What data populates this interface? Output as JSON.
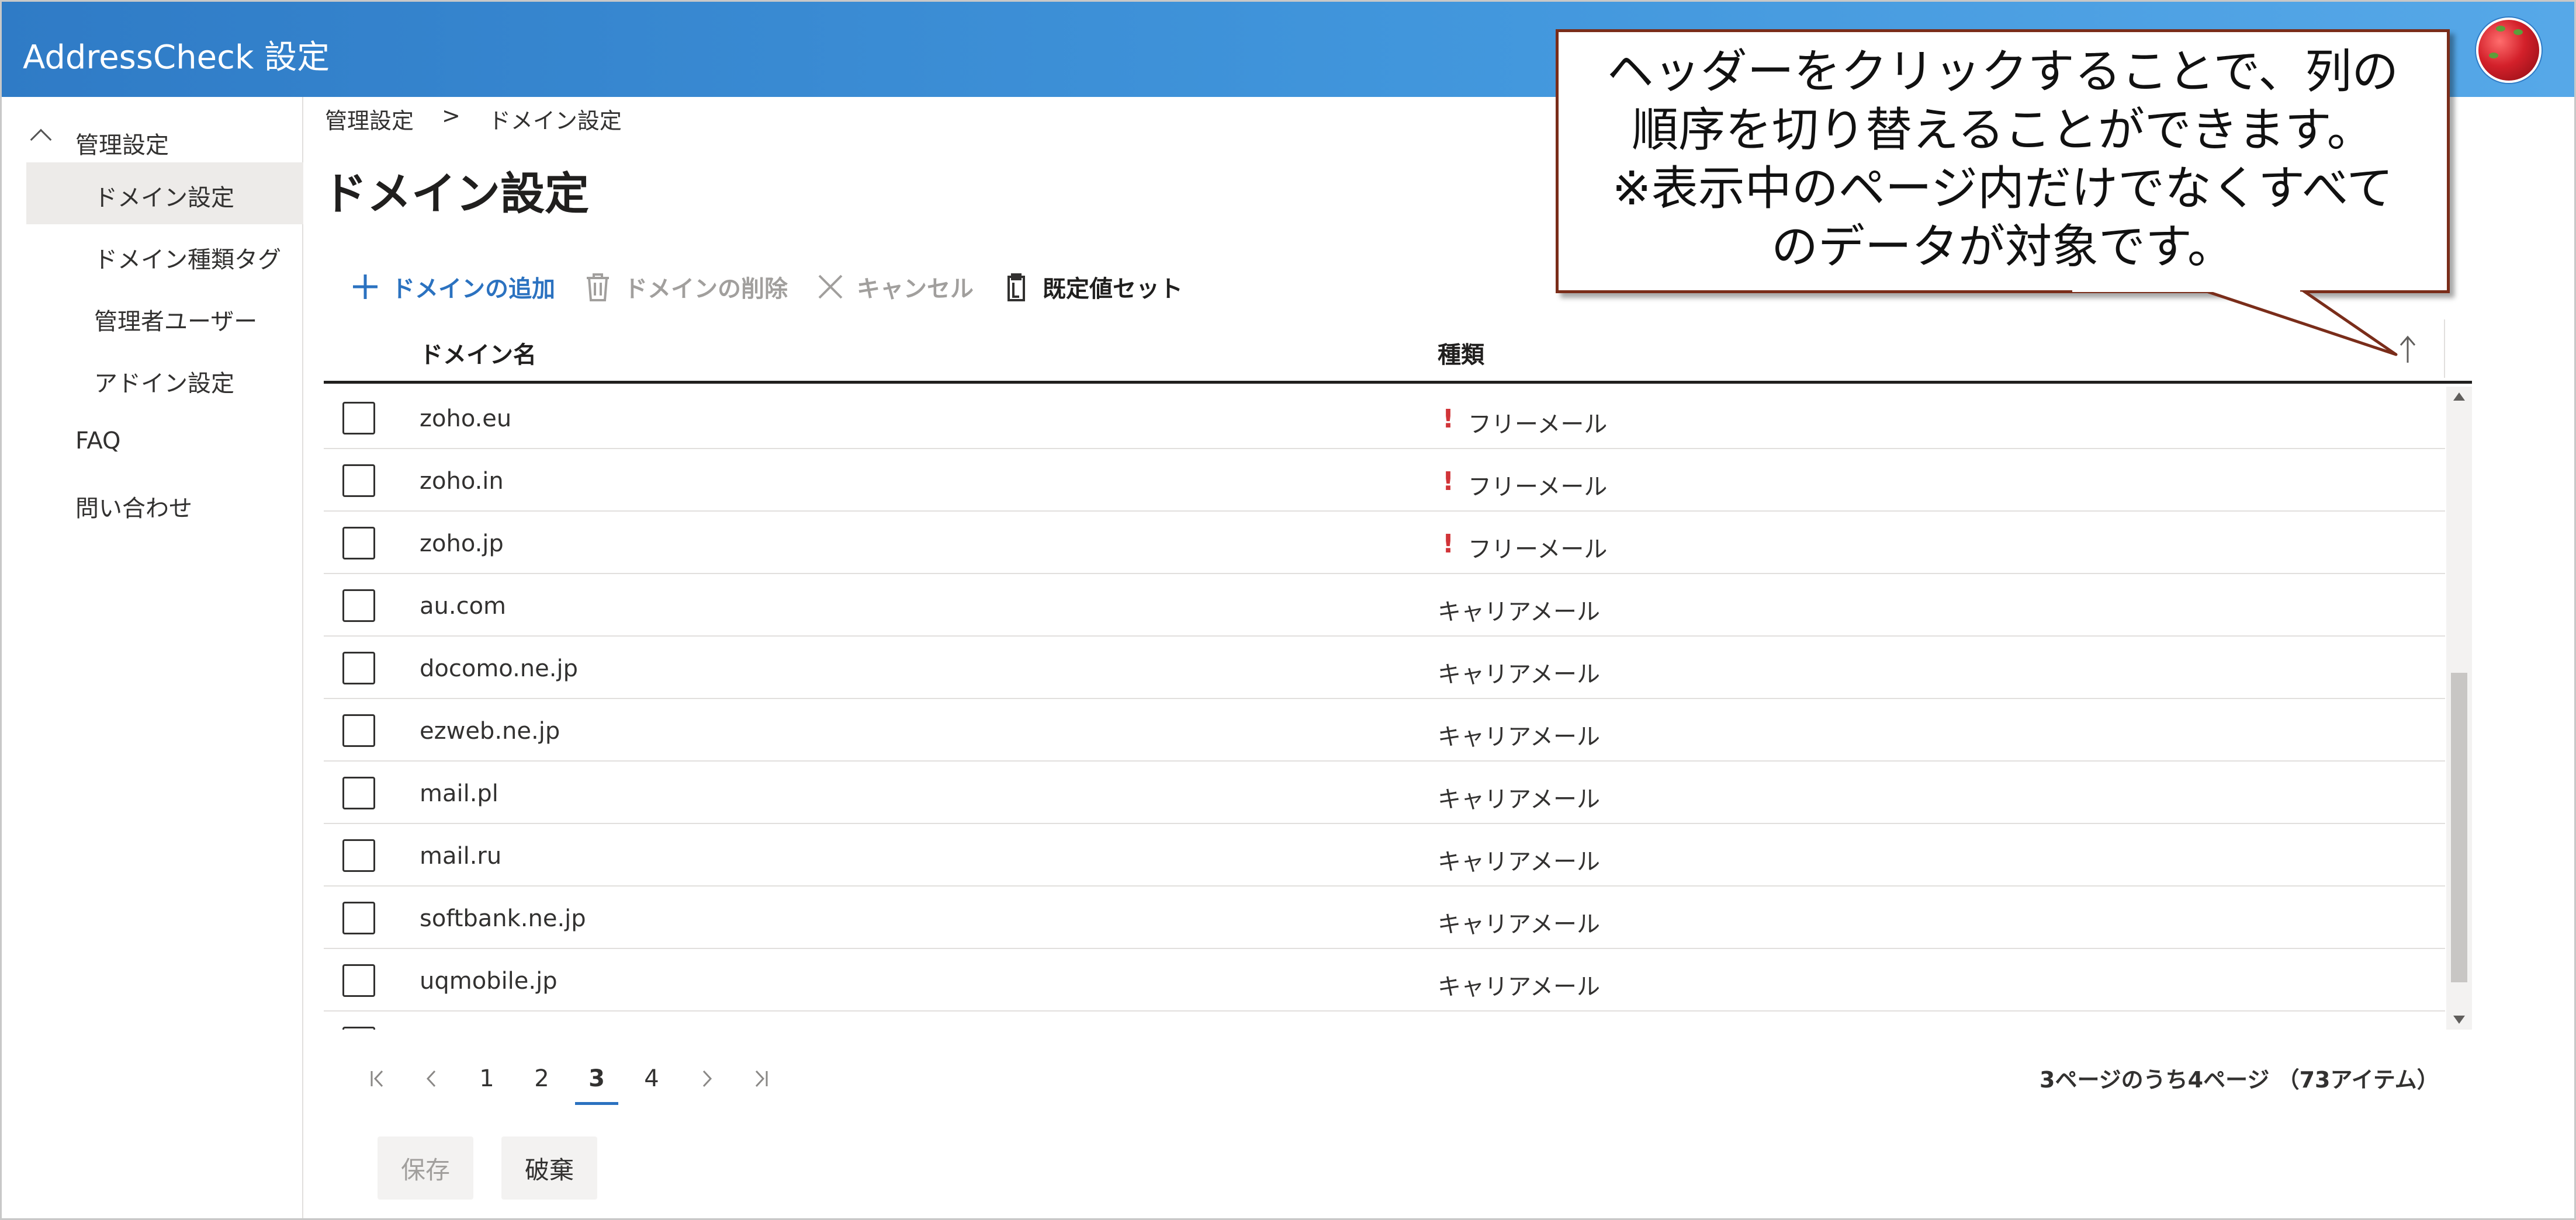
{
  "app": {
    "title": "AddressCheck 設定"
  },
  "sidebar": {
    "group": {
      "label": "管理設定",
      "expanded": true
    },
    "items": [
      {
        "label": "ドメイン設定",
        "selected": true
      },
      {
        "label": "ドメイン種類タグ",
        "selected": false
      },
      {
        "label": "管理者ユーザー",
        "selected": false
      },
      {
        "label": "アドイン設定",
        "selected": false
      }
    ],
    "top_items": [
      {
        "label": "FAQ"
      },
      {
        "label": "問い合わせ"
      }
    ]
  },
  "breadcrumb": {
    "parent": "管理設定",
    "separator": ">",
    "current": "ドメイン設定"
  },
  "page": {
    "title": "ドメイン設定"
  },
  "toolbar": {
    "add": {
      "label": "ドメインの追加",
      "icon": "plus-icon",
      "state": "enabled"
    },
    "delete": {
      "label": "ドメインの削除",
      "icon": "trash-icon",
      "state": "disabled"
    },
    "cancel": {
      "label": "キャンセル",
      "icon": "close-icon",
      "state": "disabled"
    },
    "defaults": {
      "label": "既定値セット",
      "icon": "clipboard-icon",
      "state": "enabled"
    }
  },
  "table": {
    "columns": {
      "name": "ドメイン名",
      "type": "種類",
      "sort": "ascending"
    },
    "rows": [
      {
        "name": "zoho.eu",
        "type": "フリーメール",
        "warning": "!"
      },
      {
        "name": "zoho.in",
        "type": "フリーメール",
        "warning": "!"
      },
      {
        "name": "zoho.jp",
        "type": "フリーメール",
        "warning": "!"
      },
      {
        "name": "au.com",
        "type": "キャリアメール",
        "warning": ""
      },
      {
        "name": "docomo.ne.jp",
        "type": "キャリアメール",
        "warning": ""
      },
      {
        "name": "ezweb.ne.jp",
        "type": "キャリアメール",
        "warning": ""
      },
      {
        "name": "mail.pl",
        "type": "キャリアメール",
        "warning": ""
      },
      {
        "name": "mail.ru",
        "type": "キャリアメール",
        "warning": ""
      },
      {
        "name": "softbank.ne.jp",
        "type": "キャリアメール",
        "warning": ""
      },
      {
        "name": "uqmobile.jp",
        "type": "キャリアメール",
        "warning": ""
      },
      {
        "name": "",
        "type": "",
        "warning": ""
      }
    ]
  },
  "pagination": {
    "first": "K",
    "prev": "<",
    "pages": [
      "1",
      "2",
      "3",
      "4"
    ],
    "current": "3",
    "next": ">",
    "last": ">|",
    "info": "3ページのうち4ページ （73アイテム）"
  },
  "actions": {
    "save": "保存",
    "discard": "破棄"
  },
  "callout": {
    "lines": [
      "ヘッダーをクリックすることで、列の",
      "順序を切り替えることができます。",
      "※表示中のページ内だけでなくすべて",
      "のデータが対象です。"
    ]
  },
  "colors": {
    "header_start": "#2f7bc6",
    "header_end": "#56a8e8",
    "accent": "#2b72c0",
    "warning": "#d13438",
    "callout_border": "#7a2d1a"
  }
}
